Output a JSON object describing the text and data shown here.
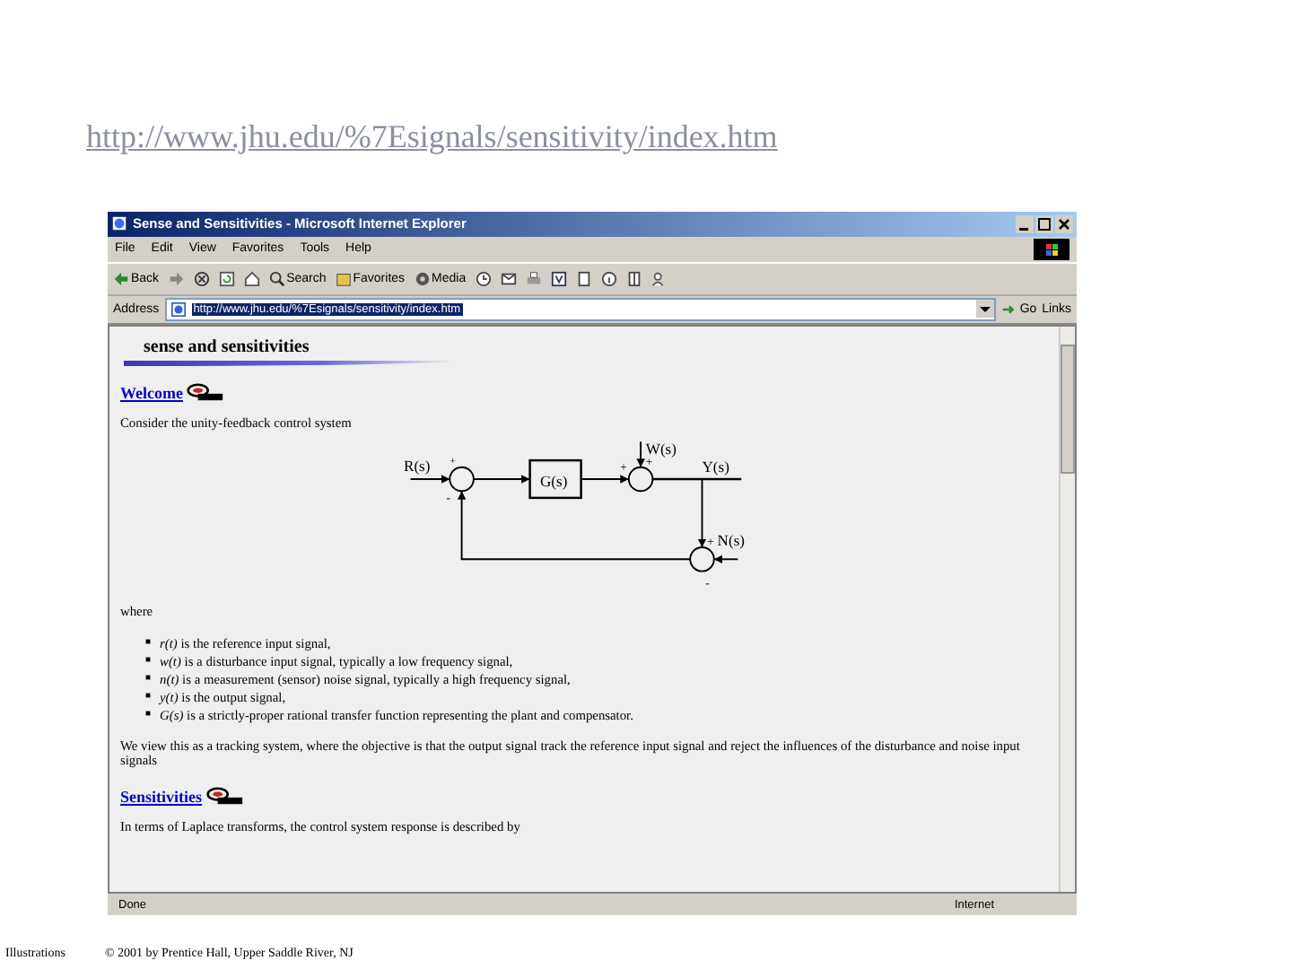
{
  "slide_url": "http://www.jhu.edu/%7Esignals/sensitivity/index.htm",
  "window": {
    "title": "Sense and Sensitivities - Microsoft Internet Explorer"
  },
  "menu": [
    "File",
    "Edit",
    "View",
    "Favorites",
    "Tools",
    "Help"
  ],
  "toolbar": [
    {
      "kind": "back",
      "label": "Back"
    },
    {
      "kind": "forward"
    },
    {
      "kind": "stop"
    },
    {
      "kind": "refresh"
    },
    {
      "kind": "home"
    },
    {
      "kind": "search",
      "label": "Search"
    },
    {
      "kind": "favorites",
      "label": "Favorites"
    },
    {
      "kind": "media",
      "label": "Media"
    },
    {
      "kind": "history"
    },
    {
      "kind": "mail"
    },
    {
      "kind": "print"
    },
    {
      "kind": "edit"
    },
    {
      "kind": "doc"
    },
    {
      "kind": "info"
    },
    {
      "kind": "page"
    },
    {
      "kind": "messenger"
    }
  ],
  "address": {
    "label": "Address",
    "value": "http://www.jhu.edu/%7Esignals/sensitivity/index.htm",
    "go": "Go",
    "links": "Links"
  },
  "page": {
    "banner": "sense and sensitivities",
    "sections": [
      {
        "heading": "Welcome",
        "text": "Consider the unity-feedback control system"
      },
      {
        "heading": "Sensitivities",
        "text": "In terms of Laplace transforms, the control system response is described by"
      }
    ],
    "diagram": {
      "input": "R(s)",
      "plant": "G(s)",
      "disturbance": "W(s)",
      "output": "Y(s)",
      "noise": "N(s)",
      "sum1_top": "+",
      "sum1_bottom": "-",
      "sum2_left": "+",
      "sum2_top": "+",
      "sum3_top": "+",
      "sum3_bottom": "-"
    },
    "where": "where",
    "bullet_marker": "■",
    "bullets": [
      "*r(t)* is the reference input signal,",
      "*w(t)* is a disturbance input signal, typically a low frequency signal,",
      "*n(t)* is a measurement (sensor) noise signal, typically a high frequency signal,",
      "*y(t)* is the output signal,",
      "*G(s)* is a strictly-proper rational transfer function representing the plant and compensator."
    ],
    "paragraph": "We view this as a tracking system, where the objective is that the output signal track the reference input signal and reject the influences of the disturbance and noise input signals"
  },
  "status_bar": {
    "status": "Done",
    "zone": "Internet"
  },
  "footer": {
    "label": "Illustrations",
    "copyright": "© 2001 by Prentice Hall, Upper Saddle River, NJ"
  }
}
